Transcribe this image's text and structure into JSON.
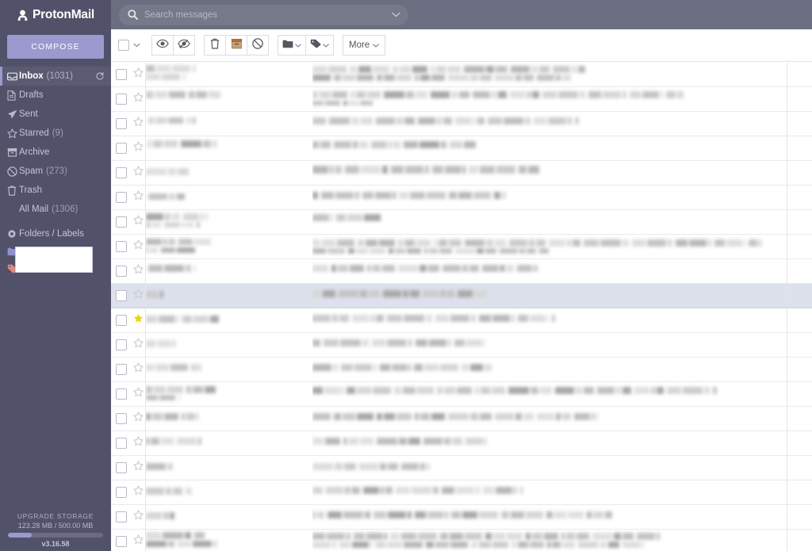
{
  "brand": {
    "name": "ProtonMail",
    "logo_icon": "proton-lock-icon"
  },
  "sidebar": {
    "compose_label": "COMPOSE",
    "items": [
      {
        "label": "Inbox",
        "count": "(1031)",
        "icon": "inbox-icon",
        "active": true,
        "refresh_icon": "refresh-icon"
      },
      {
        "label": "Drafts",
        "count": "",
        "icon": "draft-icon",
        "active": false
      },
      {
        "label": "Sent",
        "count": "",
        "icon": "sent-icon",
        "active": false
      },
      {
        "label": "Starred",
        "count": "(9)",
        "icon": "star-icon",
        "active": false
      },
      {
        "label": "Archive",
        "count": "",
        "icon": "archive-icon",
        "active": false
      },
      {
        "label": "Spam",
        "count": "(273)",
        "icon": "spam-icon",
        "active": false
      },
      {
        "label": "Trash",
        "count": "",
        "icon": "trash-icon",
        "active": false
      },
      {
        "label": "All Mail",
        "count": "(1306)",
        "icon": "",
        "active": false,
        "indent": true
      }
    ],
    "folders_label": "Folders / Labels",
    "folders_icon": "gear-icon",
    "folder_swatch_icon": "folder-icon",
    "label_swatch_icon": "tag-icon",
    "folder_name_redacted": "",
    "label_name_redacted": ""
  },
  "storage": {
    "upgrade_label": "UPGRADE STORAGE",
    "usage_text": "123.28 MB / 500.00 MB",
    "percent": 24.7,
    "version": "v3.16.58"
  },
  "search": {
    "placeholder": "Search messages",
    "value": "",
    "icon": "search-icon",
    "chevron_icon": "chevron-down-icon"
  },
  "toolbar": {
    "select_all_icon": "checkbox-icon",
    "select_all_chevron_icon": "chevron-down-icon",
    "buttons": [
      {
        "name": "mark-read-button",
        "icon": "eye-icon",
        "label": ""
      },
      {
        "name": "mark-unread-button",
        "icon": "eye-slash-icon",
        "label": ""
      },
      {
        "name": "delete-button",
        "icon": "trash-icon",
        "label": ""
      },
      {
        "name": "archive-button",
        "icon": "archive-icon",
        "label": ""
      },
      {
        "name": "spam-button",
        "icon": "ban-icon",
        "label": ""
      },
      {
        "name": "move-to-folder-button",
        "icon": "folder-icon",
        "label": ""
      },
      {
        "name": "label-as-button",
        "icon": "tag-icon",
        "label": ""
      }
    ],
    "more_label": "More",
    "more_chevron_icon": "chevron-down-icon"
  },
  "message_list": {
    "note": "All sender names, subjects and dates are blurred/redacted in the source screenshot.",
    "rows": [
      {
        "starred": false,
        "highlight": false,
        "sender_blurs": [
          [
            0,
            3,
            62,
            9
          ],
          [
            0,
            14,
            52,
            8
          ]
        ],
        "subject_blurs": [
          [
            0,
            4,
            348,
            9
          ],
          [
            0,
            15,
            330,
            8
          ]
        ]
      },
      {
        "starred": false,
        "highlight": false,
        "sender_blurs": [
          [
            0,
            5,
            98,
            9
          ]
        ],
        "subject_blurs": [
          [
            0,
            5,
            470,
            9
          ],
          [
            0,
            17,
            80,
            6
          ]
        ]
      },
      {
        "starred": false,
        "highlight": false,
        "sender_blurs": [
          [
            3,
            7,
            62,
            8
          ]
        ],
        "subject_blurs": [
          [
            0,
            7,
            338,
            9
          ]
        ]
      },
      {
        "starred": false,
        "highlight": false,
        "sender_blurs": [
          [
            2,
            5,
            92,
            9
          ]
        ],
        "subject_blurs": [
          [
            0,
            6,
            208,
            9
          ]
        ]
      },
      {
        "starred": false,
        "highlight": false,
        "sender_blurs": [
          [
            0,
            9,
            58,
            9
          ]
        ],
        "subject_blurs": [
          [
            0,
            6,
            288,
            10
          ]
        ]
      },
      {
        "starred": false,
        "highlight": false,
        "sender_blurs": [
          [
            3,
            10,
            50,
            8
          ]
        ],
        "subject_blurs": [
          [
            0,
            8,
            246,
            9
          ]
        ]
      },
      {
        "starred": false,
        "highlight": false,
        "sender_blurs": [
          [
            0,
            4,
            82,
            9
          ],
          [
            0,
            15,
            70,
            7
          ]
        ],
        "subject_blurs": [
          [
            0,
            5,
            90,
            9
          ]
        ]
      },
      {
        "starred": false,
        "highlight": false,
        "sender_blurs": [
          [
            0,
            5,
            84,
            8
          ],
          [
            0,
            16,
            64,
            7
          ]
        ],
        "subject_blurs": [
          [
            0,
            6,
            568,
            9
          ],
          [
            0,
            17,
            300,
            7
          ]
        ]
      },
      {
        "starred": false,
        "highlight": false,
        "sender_blurs": [
          [
            3,
            7,
            60,
            9
          ]
        ],
        "subject_blurs": [
          [
            0,
            7,
            286,
            9
          ]
        ]
      },
      {
        "starred": false,
        "highlight": true,
        "sender_blurs": [
          [
            0,
            9,
            24,
            9
          ]
        ],
        "subject_blurs": [
          [
            0,
            8,
            222,
            9
          ]
        ]
      },
      {
        "starred": true,
        "highlight": false,
        "sender_blurs": [
          [
            0,
            9,
            96,
            9
          ]
        ],
        "subject_blurs": [
          [
            0,
            8,
            308,
            9
          ]
        ]
      },
      {
        "starred": false,
        "highlight": false,
        "sender_blurs": [
          [
            0,
            9,
            36,
            9
          ]
        ],
        "subject_blurs": [
          [
            0,
            8,
            218,
            9
          ]
        ]
      },
      {
        "starred": false,
        "highlight": false,
        "sender_blurs": [
          [
            0,
            8,
            70,
            9
          ]
        ],
        "subject_blurs": [
          [
            0,
            8,
            230,
            9
          ]
        ]
      },
      {
        "starred": false,
        "highlight": false,
        "sender_blurs": [
          [
            0,
            5,
            92,
            9
          ],
          [
            0,
            16,
            44,
            7
          ]
        ],
        "subject_blurs": [
          [
            0,
            6,
            512,
            9
          ]
        ]
      },
      {
        "starred": false,
        "highlight": false,
        "sender_blurs": [
          [
            0,
            8,
            66,
            9
          ]
        ],
        "subject_blurs": [
          [
            0,
            8,
            362,
            9
          ]
        ]
      },
      {
        "starred": false,
        "highlight": false,
        "sender_blurs": [
          [
            0,
            8,
            72,
            9
          ]
        ],
        "subject_blurs": [
          [
            0,
            8,
            220,
            9
          ]
        ]
      },
      {
        "starred": false,
        "highlight": false,
        "sender_blurs": [
          [
            0,
            9,
            36,
            9
          ]
        ],
        "subject_blurs": [
          [
            0,
            9,
            152,
            9
          ]
        ]
      },
      {
        "starred": false,
        "highlight": false,
        "sender_blurs": [
          [
            0,
            9,
            60,
            9
          ]
        ],
        "subject_blurs": [
          [
            0,
            8,
            268,
            9
          ]
        ]
      },
      {
        "starred": false,
        "highlight": false,
        "sender_blurs": [
          [
            0,
            9,
            40,
            9
          ]
        ],
        "subject_blurs": [
          [
            0,
            8,
            382,
            9
          ]
        ]
      },
      {
        "starred": false,
        "highlight": false,
        "sender_blurs": [
          [
            0,
            3,
            76,
            9
          ],
          [
            0,
            14,
            94,
            8
          ]
        ],
        "subject_blurs": [
          [
            0,
            4,
            440,
            9
          ],
          [
            0,
            15,
            420,
            8
          ]
        ]
      }
    ]
  }
}
